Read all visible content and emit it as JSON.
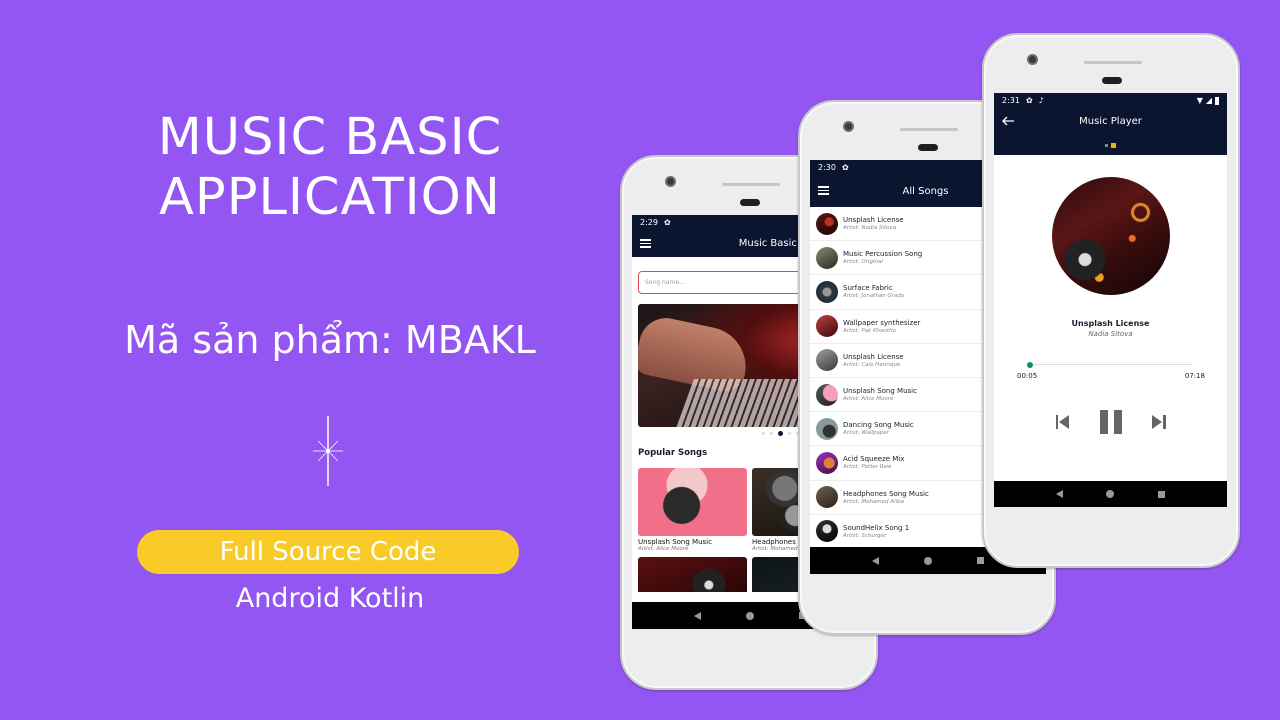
{
  "promo": {
    "title_line1": "MUSIC BASIC",
    "title_line2": "APPLICATION",
    "product_code": "Mã sản phẩm: MBAKL",
    "badge": "Full Source Code",
    "subtitle": "Android Kotlin",
    "colors": {
      "background": "#9356f2",
      "badge": "#f8cb28",
      "appbar": "#0b1530",
      "accent_seek": "#0d8a72",
      "pager_active": "#f4b400",
      "search_border": "#e8464e"
    }
  },
  "phone1": {
    "status_time": "2:29",
    "app_title": "Music Basic Java",
    "search_placeholder": "Song name...",
    "banner_pages": 5,
    "banner_active_page": 3,
    "section_title": "Popular Songs",
    "popular": [
      {
        "name": "Unsplash Song Music",
        "artist": "Artist:  Alice Moore"
      },
      {
        "name": "Headphones Song Music",
        "artist": "Artist:  Mohamed Aliba"
      }
    ]
  },
  "phone2": {
    "status_time": "2:30",
    "app_title": "All Songs",
    "songs": [
      {
        "name": "Unsplash License",
        "artist": "Artist:  Nadia Sitova"
      },
      {
        "name": "Music Percussion Song",
        "artist": "Artist:  Original"
      },
      {
        "name": "Surface Fabric",
        "artist": "Artist:  Jonathan Grado"
      },
      {
        "name": "Wallpaper synthesizer",
        "artist": "Artist:  Pak Khantho"
      },
      {
        "name": "Unsplash License",
        "artist": "Artist:  Caio Henrique"
      },
      {
        "name": "Unsplash Song Music",
        "artist": "Artist:  Alice Moore"
      },
      {
        "name": "Dancing Song Music",
        "artist": "Artist:  Wallpaper"
      },
      {
        "name": "Acid Squeeze Mix",
        "artist": "Artist:  Petter Rew"
      },
      {
        "name": "Headphones Song Music",
        "artist": "Artist:  Mohamed Aliba"
      },
      {
        "name": "SoundHelix Song 1",
        "artist": "Artist:  Schurger"
      }
    ]
  },
  "phone3": {
    "status_time": "2:31",
    "app_title": "Music Player",
    "pager_pages": 2,
    "pager_active_page": 2,
    "track_title": "Unsplash License",
    "track_artist": "Nadia Sitova",
    "elapsed": "00:05",
    "duration": "07:18",
    "progress_fraction": 0.012
  }
}
